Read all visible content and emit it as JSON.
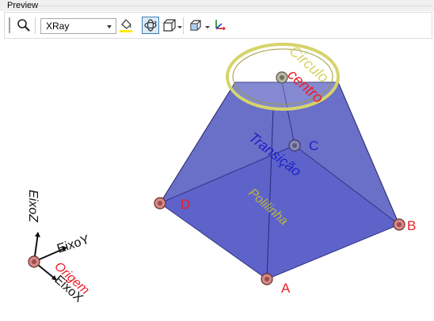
{
  "panel": {
    "title": "Preview"
  },
  "toolbar": {
    "render_mode": "XRay",
    "icons": [
      "search-icon",
      "paint-bucket-icon",
      "rotate-view-icon",
      "box-view-icon",
      "view-cube-icon",
      "axes-icon"
    ]
  },
  "scene": {
    "labels": {
      "circle_line1": "Circulo",
      "circle_line2": "centro",
      "transition": "Transição",
      "polyline": "Polilinha",
      "point_a": "A",
      "point_b": "B",
      "point_c": "C",
      "point_d": "D"
    },
    "axes": {
      "y": "EixoY",
      "x": "EixoX",
      "z": "EixoZ",
      "origin": "Origem"
    }
  },
  "colors": {
    "shape_fill": "#3f44b7",
    "ring": "#d6d46a",
    "label_red": "#ee1c25",
    "label_blue": "#1f21c8",
    "label_yellow": "#b8b73e"
  }
}
